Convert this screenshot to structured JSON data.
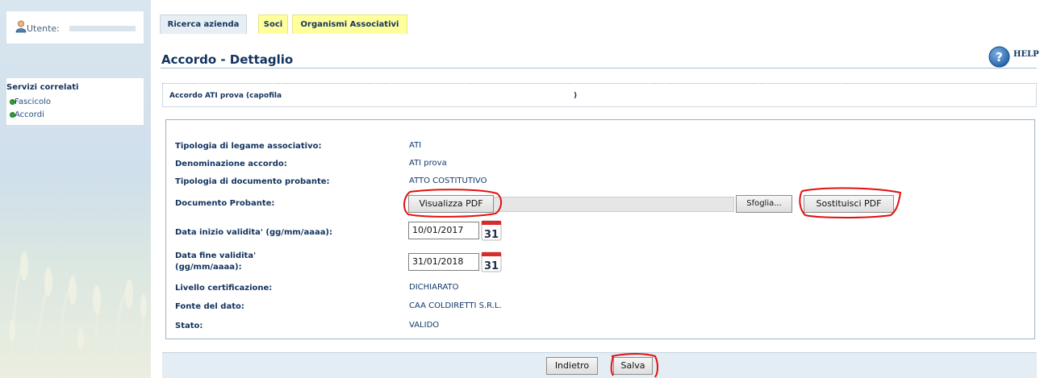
{
  "sidebar": {
    "user_label": "Utente:",
    "services_title": "Servizi correlati",
    "services_items": [
      "Fascicolo",
      "Accordi"
    ]
  },
  "tabs": [
    "Ricerca azienda",
    "Soci",
    "Organismi Associativi"
  ],
  "page": {
    "title": "Accordo - Dettaglio",
    "help_label": "HELP"
  },
  "header": {
    "text": "Accordo ATI prova (capofila",
    "closing_paren": ")"
  },
  "form": {
    "tipologia_label": "Tipologia di legame associativo:",
    "tipologia_value": "ATI",
    "denominazione_label": "Denominazione accordo:",
    "denominazione_value": "ATI prova",
    "tipo_doc_label": "Tipologia di documento probante:",
    "tipo_doc_value": "ATTO COSTITUTIVO",
    "doc_probante_label": "Documento Probante:",
    "visualizza_btn": "Visualizza PDF",
    "sfoglia_btn": "Sfoglia...",
    "sostituisci_btn": "Sostituisci PDF",
    "data_inizio_label": "Data inizio validita' (gg/mm/aaaa):",
    "data_inizio_value": "10/01/2017",
    "data_fine_label_1": "Data fine validita'",
    "data_fine_label_2": "(gg/mm/aaaa):",
    "data_fine_value": "31/01/2018",
    "calendar_day": "31",
    "livello_label": "Livello certificazione:",
    "livello_value": "DICHIARATO",
    "fonte_label": "Fonte del dato:",
    "fonte_value": "CAA COLDIRETTI S.R.L.",
    "stato_label": "Stato:",
    "stato_value": "VALIDO"
  },
  "footer": {
    "back_btn": "Indietro",
    "save_btn": "Salva"
  },
  "colors": {
    "accent_text": "#12335e",
    "yellow_tab": "#ffff9c",
    "annotation_red": "#e01010"
  }
}
